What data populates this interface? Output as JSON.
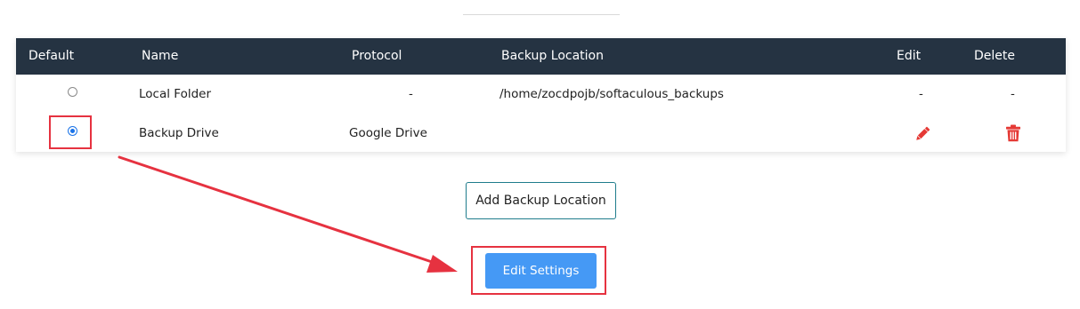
{
  "table": {
    "headers": {
      "default": "Default",
      "name": "Name",
      "protocol": "Protocol",
      "location": "Backup Location",
      "edit": "Edit",
      "delete": "Delete"
    },
    "rows": [
      {
        "selected": false,
        "name": "Local Folder",
        "protocol": "-",
        "location": "/home/zocdpojb/softaculous_backups",
        "edit": "-",
        "delete": "-"
      },
      {
        "selected": true,
        "name": "Backup Drive",
        "protocol": "Google Drive",
        "location": "",
        "edit_icon": "pencil-icon",
        "delete_icon": "trash-icon"
      }
    ]
  },
  "buttons": {
    "add_location": "Add Backup Location",
    "edit_settings": "Edit Settings"
  },
  "colors": {
    "header_bg": "#253342",
    "primary": "#4599f5",
    "radio_checked": "#1a73e8",
    "danger_icon": "#e53935",
    "annotation": "#e63240",
    "outline_border": "#1f7c8c"
  }
}
